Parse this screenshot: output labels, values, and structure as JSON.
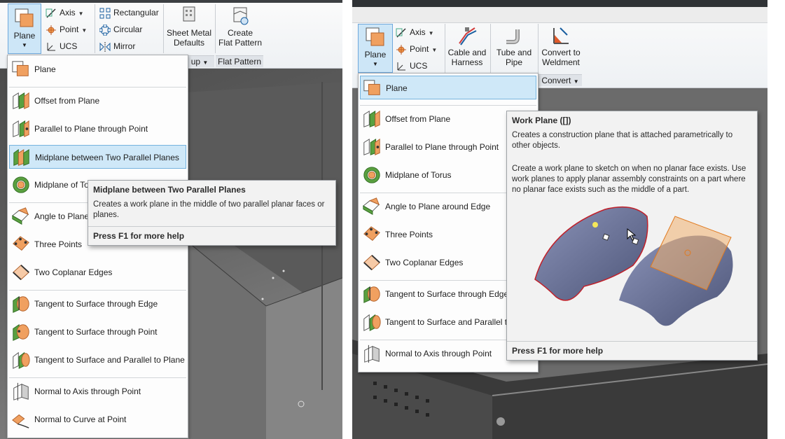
{
  "left": {
    "ribbon": {
      "plane_label": "Plane",
      "small_tools": [
        {
          "label": "Axis",
          "icon": "axis-icon"
        },
        {
          "label": "Point",
          "icon": "point-icon"
        },
        {
          "label": "UCS",
          "icon": "ucs-icon"
        }
      ],
      "pattern_tools": [
        {
          "label": "Rectangular",
          "icon": "rectangular-pattern-icon"
        },
        {
          "label": "Circular",
          "icon": "circular-pattern-icon"
        },
        {
          "label": "Mirror",
          "icon": "mirror-icon"
        }
      ],
      "sheet_metal_line1": "Sheet Metal",
      "sheet_metal_line2": "Defaults",
      "flat_pattern_line1": "Create",
      "flat_pattern_line2": "Flat Pattern",
      "group_partial": "up",
      "group_flat_pattern": "Flat Pattern"
    },
    "menu": [
      {
        "label": "Plane",
        "icon": "plane-icon"
      },
      {
        "label": "Offset from Plane",
        "icon": "offset-plane-icon"
      },
      {
        "label": "Parallel to Plane through Point",
        "icon": "parallel-plane-point-icon"
      },
      {
        "label": "Midplane between Two Parallel Planes",
        "icon": "midplane-icon",
        "highlighted": true
      },
      {
        "label": "Midplane of Torus",
        "icon": "torus-icon"
      },
      {
        "label": "Angle to Plane around Edge",
        "icon": "angle-plane-icon"
      },
      {
        "label": "Three Points",
        "icon": "three-points-icon"
      },
      {
        "label": "Two Coplanar Edges",
        "icon": "coplanar-edges-icon"
      },
      {
        "label": "Tangent to Surface through Edge",
        "icon": "tangent-edge-icon"
      },
      {
        "label": "Tangent to Surface through Point",
        "icon": "tangent-point-icon"
      },
      {
        "label": "Tangent to Surface and Parallel to Plane",
        "icon": "tangent-parallel-icon"
      },
      {
        "label": "Normal to Axis through Point",
        "icon": "normal-axis-icon"
      },
      {
        "label": "Normal to Curve at Point",
        "icon": "normal-curve-icon"
      }
    ],
    "tooltip": {
      "title": "Midplane between Two Parallel Planes",
      "body": "Creates a work plane in the middle of two parallel planar faces or planes.",
      "footer": "Press F1 for more help"
    }
  },
  "right": {
    "ribbon": {
      "plane_label": "Plane",
      "small_tools": [
        {
          "label": "Axis",
          "icon": "axis-icon"
        },
        {
          "label": "Point",
          "icon": "point-icon"
        },
        {
          "label": "UCS",
          "icon": "ucs-icon"
        }
      ],
      "cable_line1": "Cable and",
      "cable_line2": "Harness",
      "tube_line1": "Tube and",
      "tube_line2": "Pipe",
      "weldment_line1": "Convert to",
      "weldment_line2": "Weldment",
      "group_convert": "Convert"
    },
    "menu": [
      {
        "label": "Plane",
        "icon": "plane-icon",
        "highlighted": true
      },
      {
        "label": "Offset from Plane",
        "icon": "offset-plane-icon"
      },
      {
        "label": "Parallel to Plane through Point",
        "icon": "parallel-plane-point-icon"
      },
      {
        "label": "Midplane of Torus",
        "icon": "torus-icon"
      },
      {
        "label": "Angle to Plane around Edge",
        "icon": "angle-plane-icon"
      },
      {
        "label": "Three Points",
        "icon": "three-points-icon"
      },
      {
        "label": "Two Coplanar Edges",
        "icon": "coplanar-edges-icon"
      },
      {
        "label": "Tangent to Surface through Edge",
        "icon": "tangent-edge-icon"
      },
      {
        "label": "Tangent to Surface and Parallel to",
        "icon": "tangent-parallel-icon"
      },
      {
        "label": "Normal to Axis through Point",
        "icon": "normal-axis-icon"
      }
    ],
    "tooltip": {
      "title": "Work Plane ([])",
      "body1": "Creates a construction plane that is attached parametrically to other objects.",
      "body2": "Create a work plane to sketch on when no planar face exists. Use work planes to apply planar assembly constraints on a part where no planar face exists such as the middle of a part.",
      "footer": "Press F1 for more help"
    }
  },
  "colors": {
    "accent_highlight": "#cfe8f8",
    "accent_border": "#75b3de",
    "plane_orange": "#f0a060",
    "plane_green": "#5aa040"
  }
}
